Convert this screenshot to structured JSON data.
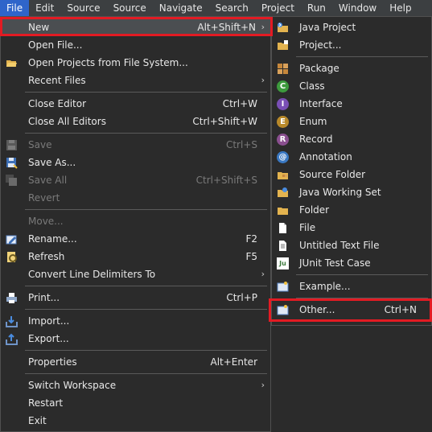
{
  "menubar": {
    "items": [
      "File",
      "Edit",
      "Source",
      "Source",
      "Navigate",
      "Search",
      "Project",
      "Run",
      "Window",
      "Help"
    ]
  },
  "file_menu": {
    "new": {
      "label": "New",
      "shortcut": "Alt+Shift+N"
    },
    "open_file": {
      "label": "Open File..."
    },
    "open_projects": {
      "label": "Open Projects from File System..."
    },
    "recent_files": {
      "label": "Recent Files"
    },
    "close_editor": {
      "label": "Close Editor",
      "shortcut": "Ctrl+W"
    },
    "close_all": {
      "label": "Close All Editors",
      "shortcut": "Ctrl+Shift+W"
    },
    "save": {
      "label": "Save",
      "shortcut": "Ctrl+S"
    },
    "save_as": {
      "label": "Save As..."
    },
    "save_all": {
      "label": "Save All",
      "shortcut": "Ctrl+Shift+S"
    },
    "revert": {
      "label": "Revert"
    },
    "move": {
      "label": "Move..."
    },
    "rename": {
      "label": "Rename...",
      "shortcut": "F2"
    },
    "refresh": {
      "label": "Refresh",
      "shortcut": "F5"
    },
    "convert": {
      "label": "Convert Line Delimiters To"
    },
    "print": {
      "label": "Print...",
      "shortcut": "Ctrl+P"
    },
    "import": {
      "label": "Import..."
    },
    "export": {
      "label": "Export..."
    },
    "properties": {
      "label": "Properties",
      "shortcut": "Alt+Enter"
    },
    "switch_workspace": {
      "label": "Switch Workspace"
    },
    "restart": {
      "label": "Restart"
    },
    "exit": {
      "label": "Exit"
    }
  },
  "new_menu": {
    "java_project": {
      "label": "Java Project"
    },
    "project": {
      "label": "Project..."
    },
    "package": {
      "label": "Package"
    },
    "class": {
      "label": "Class"
    },
    "interface": {
      "label": "Interface"
    },
    "enum": {
      "label": "Enum"
    },
    "record": {
      "label": "Record"
    },
    "annotation": {
      "label": "Annotation"
    },
    "source_folder": {
      "label": "Source Folder"
    },
    "java_working_set": {
      "label": "Java Working Set"
    },
    "folder": {
      "label": "Folder"
    },
    "file": {
      "label": "File"
    },
    "untitled_text_file": {
      "label": "Untitled Text File"
    },
    "junit_test_case": {
      "label": "JUnit Test Case"
    },
    "example": {
      "label": "Example..."
    },
    "other": {
      "label": "Other...",
      "shortcut": "Ctrl+N"
    }
  },
  "glyphs": {
    "submenu_arrow": "›",
    "class_letter": "C",
    "interface_letter": "I",
    "enum_letter": "E",
    "record_letter": "R",
    "annotation_letter": "@",
    "junit_letter": "Ju"
  },
  "colors": {
    "menubar_active": "#2f65ca",
    "highlight_box": "#e31b23"
  }
}
